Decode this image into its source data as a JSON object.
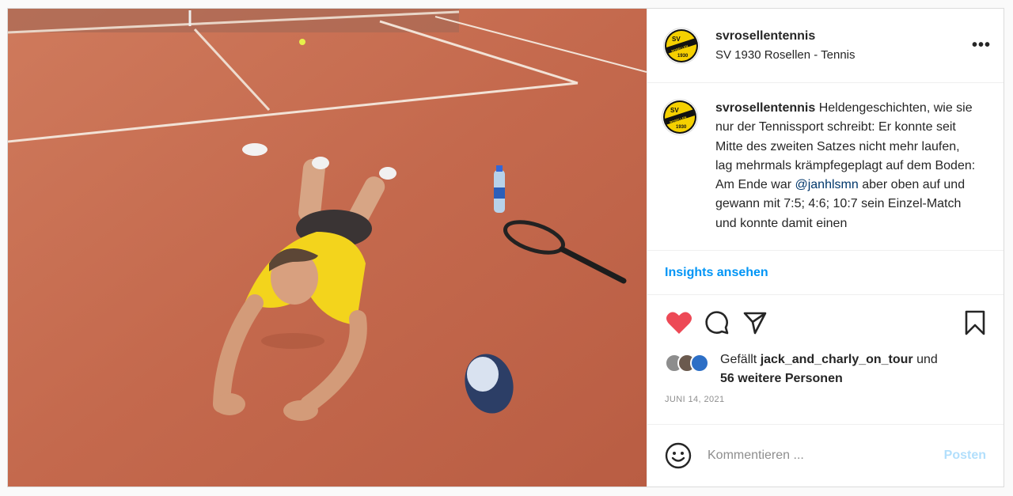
{
  "post": {
    "image_alt": "Tennis player lying on clay court",
    "header": {
      "username": "svrosellentennis",
      "location": "SV 1930 Rosellen - Tennis",
      "more_label": "•••"
    },
    "avatar": {
      "top": "SV",
      "bottom": "1930",
      "band": "ROSELLEN"
    },
    "caption": {
      "username": "svrosellentennis",
      "text_1": " Heldengeschichten, wie sie nur der Tennissport schreibt: Er konnte seit Mitte des zweiten Satzes nicht mehr laufen, lag mehrmals krämpfegeplagt auf dem Boden: Am Ende war ",
      "mention": "@janhlsmn",
      "text_2": " aber oben auf und gewann mit 7:5; 4:6; 10:7 sein Einzel-Match und konnte damit einen"
    },
    "insights_label": "Insights ansehen",
    "actions": [
      "heart-icon",
      "comment-icon",
      "share-icon",
      "bookmark-icon"
    ],
    "likes": {
      "prefix": "Gefällt ",
      "user": "jack_and_charly_on_tour",
      "middle": " und",
      "others": "56 weitere Personen"
    },
    "date": "JUNI 14, 2021",
    "comment": {
      "placeholder": "Kommentieren ...",
      "post_label": "Posten"
    }
  },
  "colors": {
    "like": "#ed4956",
    "link": "#0095f6",
    "mention": "#00376b",
    "post_disabled": "#b2dffc",
    "avatar_yellow": "#f5d000"
  }
}
